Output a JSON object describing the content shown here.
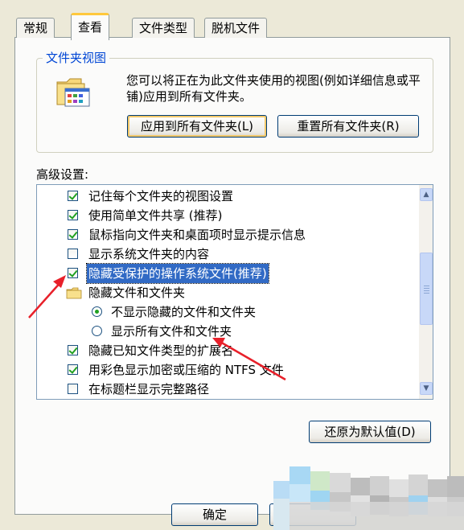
{
  "tabs": [
    {
      "label": "常规",
      "active": false
    },
    {
      "label": "查看",
      "active": true
    },
    {
      "label": "文件类型",
      "active": false
    },
    {
      "label": "脱机文件",
      "active": false
    }
  ],
  "folder_views": {
    "title": "文件夹视图",
    "description": "您可以将正在为此文件夹使用的视图(例如详细信息或平铺)应用到所有文件夹。",
    "apply_button": "应用到所有文件夹(L)",
    "reset_button": "重置所有文件夹(R)"
  },
  "advanced": {
    "label": "高级设置:",
    "items": [
      {
        "type": "checkbox",
        "checked": true,
        "label": "记住每个文件夹的视图设置"
      },
      {
        "type": "checkbox",
        "checked": true,
        "label": "使用简单文件共享 (推荐)"
      },
      {
        "type": "checkbox",
        "checked": true,
        "label": "鼠标指向文件夹和桌面项时显示提示信息"
      },
      {
        "type": "checkbox",
        "checked": false,
        "label": "显示系统文件夹的内容"
      },
      {
        "type": "checkbox",
        "checked": true,
        "label": "隐藏受保护的操作系统文件(推荐)",
        "selected": true
      },
      {
        "type": "folder",
        "label": "隐藏文件和文件夹"
      },
      {
        "type": "radio",
        "checked": true,
        "label": "不显示隐藏的文件和文件夹"
      },
      {
        "type": "radio",
        "checked": false,
        "label": "显示所有文件和文件夹"
      },
      {
        "type": "checkbox",
        "checked": true,
        "label": "隐藏已知文件类型的扩展名"
      },
      {
        "type": "checkbox",
        "checked": true,
        "label": "用彩色显示加密或压缩的 NTFS 文件"
      },
      {
        "type": "checkbox",
        "checked": false,
        "label": "在标题栏显示完整路径"
      }
    ],
    "restore_button": "还原为默认值(D)"
  },
  "footer": {
    "ok_button": "确定"
  },
  "colors": {
    "accent_tab": "#ffc83c",
    "selection": "#316ac5",
    "annotation_arrow": "#e8202a",
    "check_green": "#21a121"
  }
}
